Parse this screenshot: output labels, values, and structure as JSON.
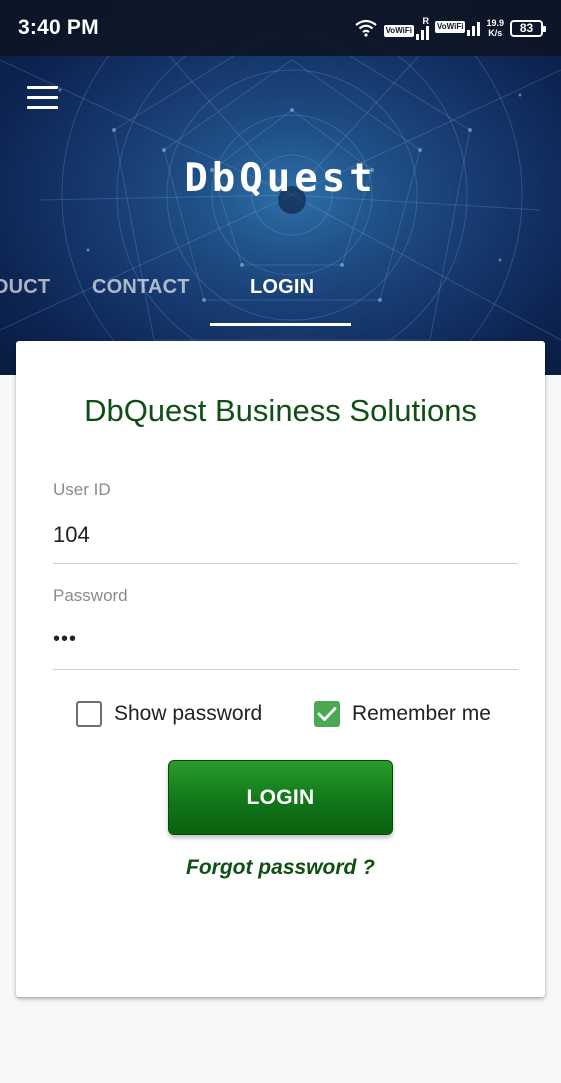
{
  "status_bar": {
    "time": "3:40 PM",
    "network_label_1": "VoWiFi",
    "roaming_mark": "R",
    "network_label_2": "VoWiFi",
    "speed_value": "19.9",
    "speed_unit": "K/s",
    "battery": "83"
  },
  "header": {
    "logo_text": "DbQuest",
    "tabs": [
      {
        "label": "DUCT"
      },
      {
        "label": "CONTACT"
      },
      {
        "label": "LOGIN"
      }
    ],
    "active_tab": "LOGIN"
  },
  "login_card": {
    "title": "DbQuest Business Solutions",
    "user_id": {
      "label": "User ID",
      "value": "104"
    },
    "password": {
      "label": "Password",
      "value": "•••"
    },
    "show_password": {
      "label": "Show password",
      "checked": false
    },
    "remember_me": {
      "label": "Remember me",
      "checked": true
    },
    "login_button": "LOGIN",
    "forgot_password": "Forgot password ?"
  },
  "colors": {
    "header_dark": "#0d2452",
    "brand_green": "#0f4f14",
    "button_green": "#11771a",
    "checkbox_green": "#4aa853"
  }
}
